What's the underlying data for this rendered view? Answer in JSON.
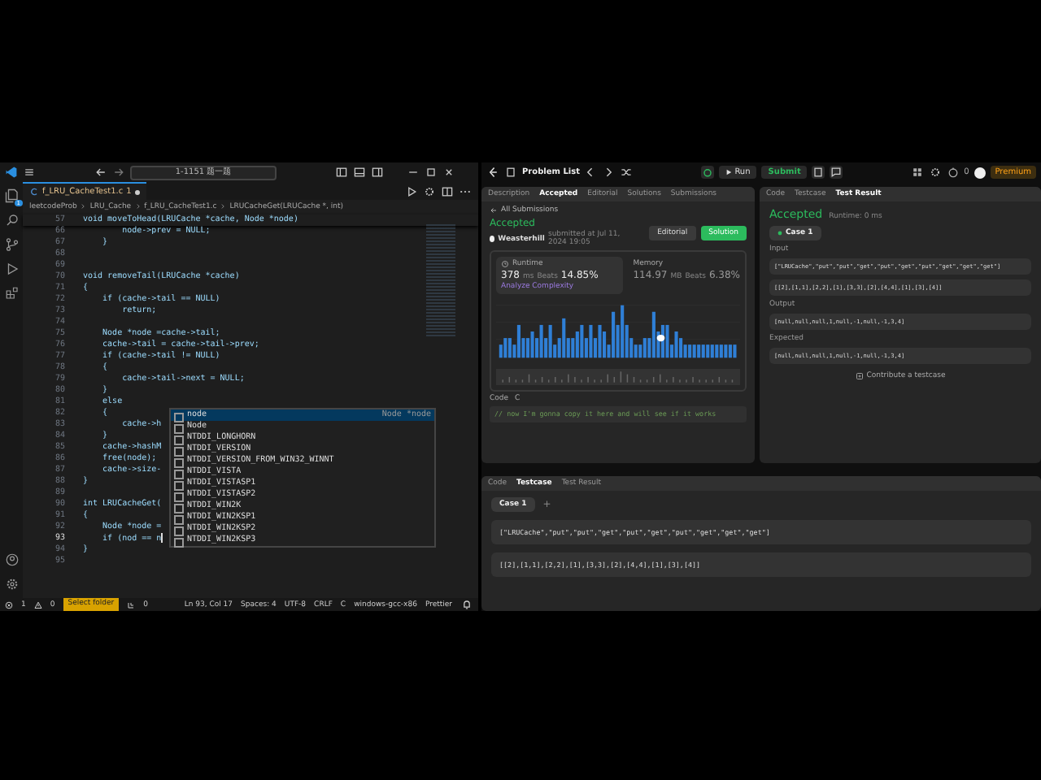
{
  "vscode": {
    "title_search": "1-1151 题一题",
    "explorer_badge": "1",
    "tab": {
      "label": "f_LRU_CacheTest1.c",
      "problems": "1",
      "modified": true
    },
    "breadcrumbs": [
      "leetcodeProb",
      "LRU_Cache",
      "f_LRU_CacheTest1.c",
      "LRUCacheGet(LRUCache *, int)"
    ],
    "sticky": {
      "number": "57",
      "text": "void moveToHead(LRUCache *cache, Node *node)"
    },
    "lines": [
      {
        "number": "66",
        "text": "        node->prev = NULL;",
        "current": false
      },
      {
        "number": "67",
        "text": "    }",
        "current": false
      },
      {
        "number": "68",
        "current": false
      },
      {
        "number": "69",
        "current": false
      },
      {
        "number": "70",
        "text": "void removeTail(LRUCache *cache)",
        "current": false
      },
      {
        "number": "71",
        "text": "{",
        "current": false
      },
      {
        "number": "72",
        "text": "    if (cache->tail == NULL)",
        "current": false
      },
      {
        "number": "73",
        "text": "        return;",
        "current": false
      },
      {
        "number": "74",
        "current": false
      },
      {
        "number": "75",
        "text": "    Node *node =cache->tail;",
        "current": false
      },
      {
        "number": "76",
        "text": "    cache->tail = cache->tail->prev;",
        "current": false
      },
      {
        "number": "77",
        "text": "    if (cache->tail != NULL)",
        "current": false
      },
      {
        "number": "78",
        "text": "    {",
        "current": false
      },
      {
        "number": "79",
        "text": "        cache->tail->next = NULL;",
        "current": false
      },
      {
        "number": "80",
        "text": "    }",
        "current": false
      },
      {
        "number": "81",
        "text": "    else",
        "current": false
      },
      {
        "number": "82",
        "text": "    {",
        "current": false
      },
      {
        "number": "83",
        "text": "        cache->h",
        "current": false
      },
      {
        "number": "84",
        "text": "    }",
        "current": false
      },
      {
        "number": "85",
        "text": "    cache->hashM",
        "current": false
      },
      {
        "number": "86",
        "text": "    free(node);",
        "current": false
      },
      {
        "number": "87",
        "text": "    cache->size-",
        "current": false
      },
      {
        "number": "88",
        "text": "}",
        "current": false
      },
      {
        "number": "89",
        "current": false
      },
      {
        "number": "90",
        "text": "int LRUCacheGet(",
        "current": false
      },
      {
        "number": "91",
        "text": "{",
        "current": false
      },
      {
        "number": "92",
        "text": "    Node *node =",
        "current": false
      },
      {
        "number": "93",
        "text": "    if (nod == n",
        "current": true
      },
      {
        "number": "94",
        "text": "}",
        "current": false
      },
      {
        "number": "95",
        "current": false
      }
    ],
    "suggestions": [
      {
        "label": "node",
        "detail": "Node *node",
        "selected": true
      },
      {
        "label": "Node",
        "selected": false
      },
      {
        "label": "NTDDI_LONGHORN",
        "selected": false
      },
      {
        "label": "NTDDI_VERSION",
        "selected": false
      },
      {
        "label": "NTDDI_VERSION_FROM_WIN32_WINNT",
        "selected": false
      },
      {
        "label": "NTDDI_VISTA",
        "selected": false
      },
      {
        "label": "NTDDI_VISTASP1",
        "selected": false
      },
      {
        "label": "NTDDI_VISTASP2",
        "selected": false
      },
      {
        "label": "NTDDI_WIN2K",
        "selected": false
      },
      {
        "label": "NTDDI_WIN2KSP1",
        "selected": false
      },
      {
        "label": "NTDDI_WIN2KSP2",
        "selected": false
      },
      {
        "label": "NTDDI_WIN2KSP3",
        "selected": false
      }
    ],
    "status": {
      "errors": "1",
      "warnings": "0",
      "folder": "Select folder",
      "ports": "0",
      "items": [
        "Ln 93, Col 17",
        "Spaces: 4",
        "UTF-8",
        "CRLF",
        "C",
        "windows-gcc-x86",
        "Prettier"
      ]
    }
  },
  "leetcode": {
    "nav_title": "Problem List",
    "run": "Run",
    "submit": "Submit",
    "streak": "0",
    "premium": "Premium",
    "left_tabs": [
      {
        "label": "Description",
        "selected": false
      },
      {
        "label": "Accepted",
        "selected": true
      },
      {
        "label": "Editorial",
        "selected": false
      },
      {
        "label": "Solutions",
        "selected": false
      },
      {
        "label": "Submissions",
        "selected": false
      }
    ],
    "back": "All Submissions",
    "status": "Accepted",
    "user": "Weasterhill",
    "submitted": "submitted at Jul 11, 2024 19:05",
    "editorial": "Editorial",
    "solution": "Solution",
    "runtime": {
      "label": "Runtime",
      "value": "378",
      "unit": "ms",
      "beats_label": "Beats",
      "beats": "14.85%",
      "link": "Analyze Complexity"
    },
    "memory": {
      "label": "Memory",
      "value": "114.97",
      "unit": "MB",
      "beats_label": "Beats",
      "beats": "6.38%"
    },
    "code_label": "Code",
    "lang": "C",
    "code_line": "// now I'm gonna copy it here and will see if it works",
    "right_tabs": [
      {
        "label": "Code",
        "selected": false
      },
      {
        "label": "Testcase",
        "selected": false
      },
      {
        "label": "Test Result",
        "selected": true
      }
    ],
    "result": {
      "status": "Accepted",
      "runtime": "Runtime: 0 ms",
      "case": "Case 1",
      "sections": [
        {
          "label": "Input",
          "values": [
            "[\"LRUCache\",\"put\",\"put\",\"get\",\"put\",\"get\",\"put\",\"get\",\"get\",\"get\"]",
            "[[2],[1,1],[2,2],[1],[3,3],[2],[4,4],[1],[3],[4]]"
          ]
        },
        {
          "label": "Output",
          "values": [
            "[null,null,null,1,null,-1,null,-1,3,4]"
          ]
        },
        {
          "label": "Expected",
          "values": [
            "[null,null,null,1,null,-1,null,-1,3,4]"
          ]
        }
      ],
      "contribute": "Contribute a testcase"
    },
    "bottom": {
      "tabs": [
        {
          "label": "Code",
          "selected": false
        },
        {
          "label": "Testcase",
          "selected": true
        },
        {
          "label": "Test Result",
          "selected": false
        }
      ],
      "case": "Case 1",
      "add": "+",
      "values": [
        "[\"LRUCache\",\"put\",\"put\",\"get\",\"put\",\"get\",\"put\",\"get\",\"get\",\"get\"]",
        "[[2],[1,1],[2,2],[1],[3,3],[2],[4,4],[1],[3],[4]]"
      ]
    }
  }
}
